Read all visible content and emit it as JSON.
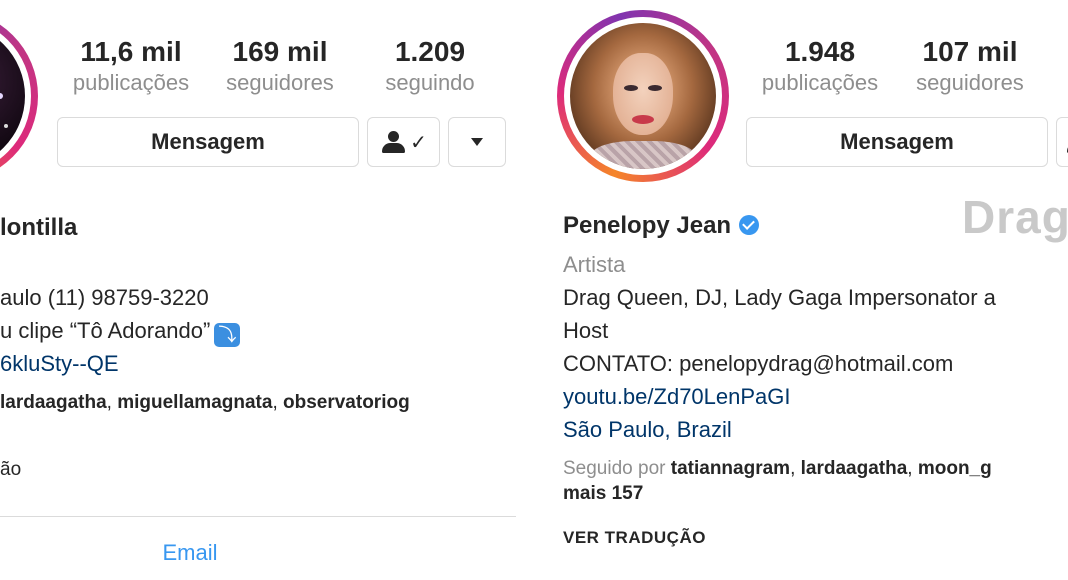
{
  "left": {
    "stats": [
      {
        "value": "11,6 mil",
        "label": "publicações"
      },
      {
        "value": "169 mil",
        "label": "seguidores"
      },
      {
        "value": "1.209",
        "label": "seguindo"
      }
    ],
    "message_button": "Mensagem",
    "following_check": "✓",
    "name": "lontilla",
    "bio_lines": [
      "aulo (11) 98759-3220",
      "u clipe “Tô Adorando”",
      "6kluSty--QE"
    ],
    "followed_by_names": "lardaagatha",
    "followed_by_sep1": ", ",
    "followed_by_names2": "miguellamagnata",
    "followed_by_sep2": ", ",
    "followed_by_names3": "observatoriog",
    "translation_fragment": "ão",
    "email_button": "Email",
    "arrow_emoji": "⤵"
  },
  "right": {
    "stats": [
      {
        "value": "1.948",
        "label": "publicações"
      },
      {
        "value": "107 mil",
        "label": "seguidores"
      }
    ],
    "message_button": "Mensagem",
    "name": "Penelopy Jean",
    "category": "Artista",
    "bio_lines": [
      "Drag Queen, DJ, Lady Gaga Impersonator a",
      "Host",
      "CONTATO: penelopydrag@hotmail.com"
    ],
    "link": "youtu.be/Zd70LenPaGI",
    "location": "São Paulo, Brazil",
    "followed_by_prefix": "Seguido por ",
    "followed_by_names": "tatiannagram",
    "followed_by_sep1": ", ",
    "followed_by_names2": "lardaagatha",
    "followed_by_sep2": ", ",
    "followed_by_names3": "moon_g",
    "followed_by_more": "mais 157",
    "translate": "VER TRADUÇÃO",
    "watermark": "Drag"
  }
}
